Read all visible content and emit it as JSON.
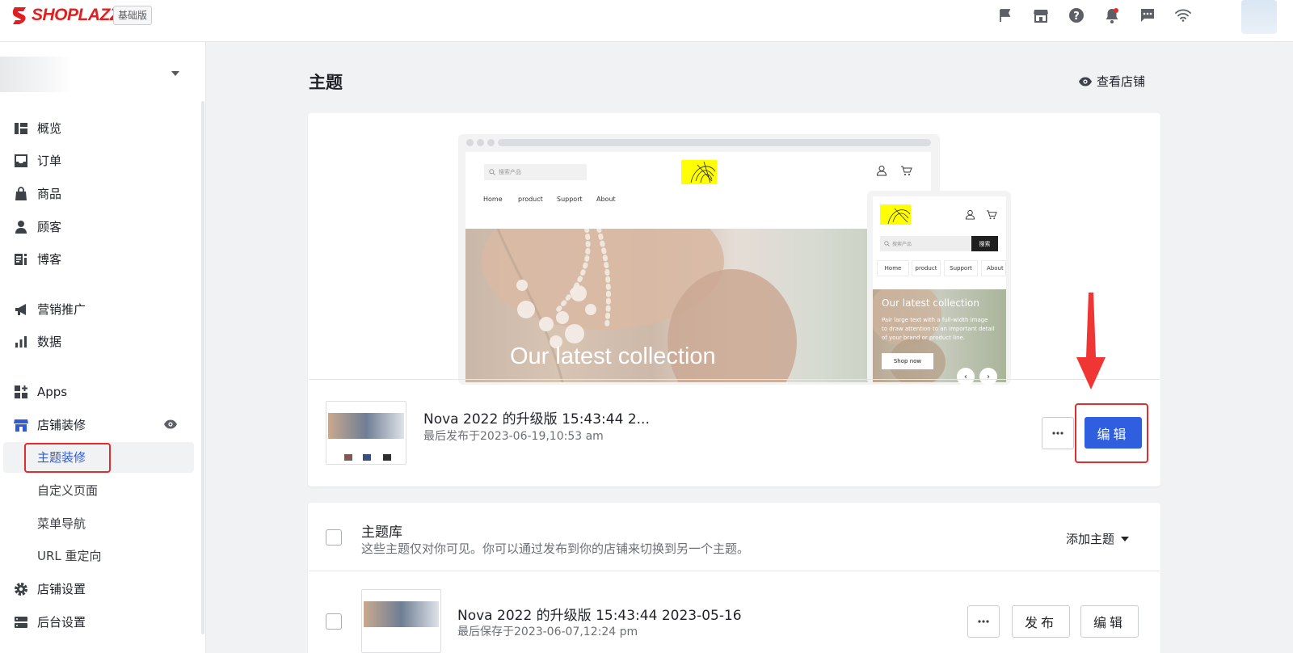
{
  "brand": {
    "name": "SHOPLAZZA",
    "plan_badge": "基础版",
    "color": "#e02020",
    "accent": "#2f5fde"
  },
  "topbar": {
    "icons": [
      "flag-icon",
      "store-icon",
      "help-icon",
      "bell-icon",
      "chat-icon",
      "wifi-icon"
    ]
  },
  "sidebar": {
    "items": [
      {
        "label": "概览",
        "icon": "dashboard-icon"
      },
      {
        "label": "订单",
        "icon": "inbox-icon"
      },
      {
        "label": "商品",
        "icon": "bag-icon"
      },
      {
        "label": "顾客",
        "icon": "person-icon"
      },
      {
        "label": "博客",
        "icon": "blog-icon"
      },
      {
        "label": "营销推广",
        "icon": "megaphone-icon"
      },
      {
        "label": "数据",
        "icon": "bar-chart-icon"
      },
      {
        "label": "Apps",
        "icon": "apps-icon"
      },
      {
        "label": "店铺装修",
        "icon": "storefront-icon"
      },
      {
        "label": "主题装修",
        "active": true
      },
      {
        "label": "自定义页面"
      },
      {
        "label": "菜单导航"
      },
      {
        "label": "URL 重定向"
      },
      {
        "label": "店铺设置",
        "icon": "gear-icon"
      },
      {
        "label": "后台设置",
        "icon": "server-icon"
      }
    ]
  },
  "page": {
    "title": "主题",
    "view_store": "查看店铺"
  },
  "preview": {
    "search_placeholder": "搜索产品",
    "nav": [
      "Home",
      "product",
      "Support",
      "About"
    ],
    "hero_title": "Our latest collection",
    "mobile_search_button": "搜索",
    "mobile_hero_text": "Pair large text with a full-width image to draw attention to an important detail of your brand or product line.",
    "mobile_shop_button": "Shop now"
  },
  "current_theme": {
    "name": "Nova 2022 的升级版 15:43:44 2...",
    "meta": "最后发布于2023-06-19,10:53 am",
    "edit_label": "编辑"
  },
  "library": {
    "title": "主题库",
    "description": "这些主题仅对你可见。你可以通过发布到你的店铺来切换到另一个主题。",
    "add_theme": "添加主题",
    "themes": [
      {
        "name": "Nova 2022 的升级版 15:43:44 2023-05-16",
        "meta": "最后保存于2023-06-07,12:24 pm",
        "publish_label": "发布",
        "edit_label": "编辑"
      }
    ]
  }
}
